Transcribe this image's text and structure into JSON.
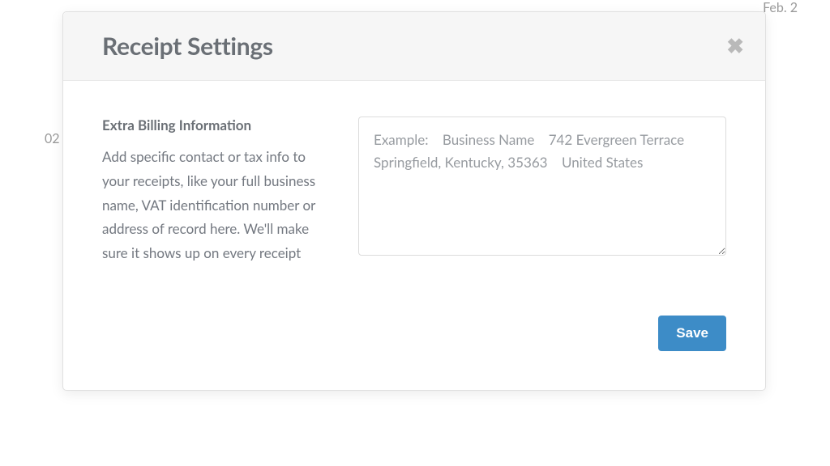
{
  "background": {
    "top_right": "Feb. 2",
    "left": "02"
  },
  "modal": {
    "title": "Receipt Settings",
    "close_glyph": "✖",
    "section": {
      "heading": "Extra Billing Information",
      "description": "Add specific contact or tax info to your receipts, like your full business name, VAT identification number or address of record here. We'll make sure it shows up on every receipt"
    },
    "textarea": {
      "value": "",
      "placeholder": "Example:    Business Name    742 Evergreen Terrace    Springfield, Kentucky, 35363    United States"
    },
    "footer": {
      "save_label": "Save"
    }
  }
}
